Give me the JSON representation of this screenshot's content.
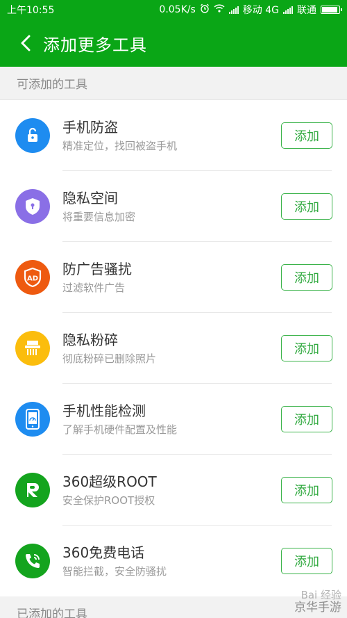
{
  "status_bar": {
    "time": "上午10:55",
    "speed": "0.05K/s",
    "carrier1": "移动 4G",
    "carrier2": "联通"
  },
  "header": {
    "title": "添加更多工具"
  },
  "sections": {
    "available_label": "可添加的工具",
    "added_label": "已添加的工具"
  },
  "tools": [
    {
      "name": "手机防盗",
      "desc": "精准定位，找回被盗手机",
      "button": "添加",
      "color": "#1e8cf0",
      "icon": "unlock-icon"
    },
    {
      "name": "隐私空间",
      "desc": "将重要信息加密",
      "button": "添加",
      "color": "#8a6fe6",
      "icon": "shield-lock-icon"
    },
    {
      "name": "防广告骚扰",
      "desc": "过滤软件广告",
      "button": "添加",
      "color": "#ee5a10",
      "icon": "ad-shield-icon"
    },
    {
      "name": "隐私粉碎",
      "desc": "彻底粉碎已删除照片",
      "button": "添加",
      "color": "#fbbd0d",
      "icon": "shredder-icon"
    },
    {
      "name": "手机性能检测",
      "desc": "了解手机硬件配置及性能",
      "button": "添加",
      "color": "#1e8cf0",
      "icon": "phone-gauge-icon"
    },
    {
      "name": "360超级ROOT",
      "desc": "安全保护ROOT授权",
      "button": "添加",
      "color": "#14a41e",
      "icon": "root-r-icon"
    },
    {
      "name": "360免费电话",
      "desc": "智能拦截，安全防骚扰",
      "button": "添加",
      "color": "#14a41e",
      "icon": "phone-call-icon"
    }
  ],
  "watermark": {
    "line1": "Bai 经验",
    "line2": "京华手游"
  }
}
